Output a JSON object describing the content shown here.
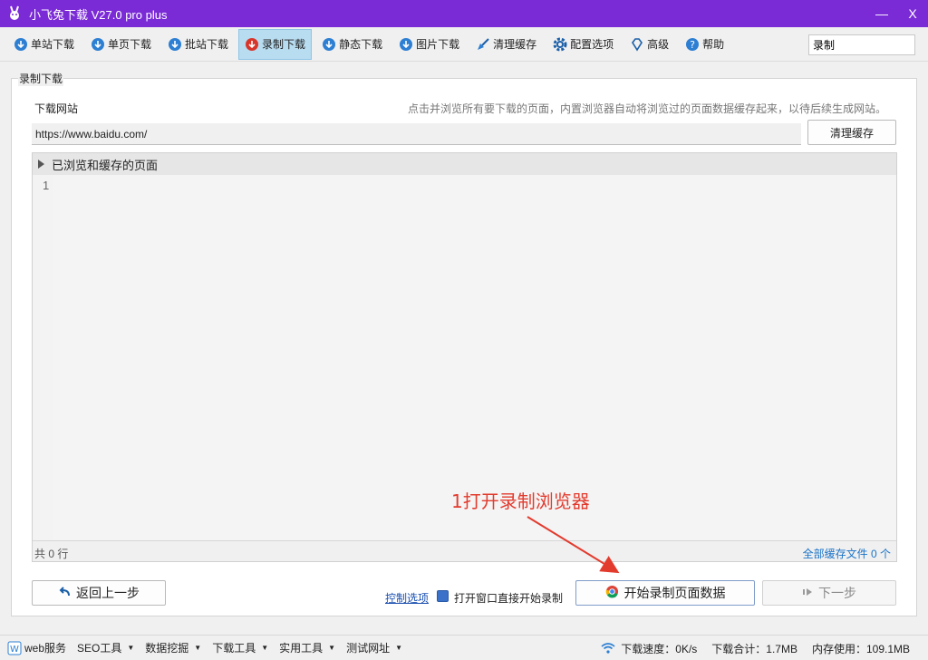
{
  "window": {
    "title": "小飞兔下载 V27.0 pro plus",
    "minimize": "—",
    "close": "X"
  },
  "toolbar": {
    "items": [
      {
        "label": "单站下载",
        "icon": "cloud-download-icon"
      },
      {
        "label": "单页下载",
        "icon": "cloud-download-icon"
      },
      {
        "label": "批站下载",
        "icon": "cloud-download-icon"
      },
      {
        "label": "录制下载",
        "icon": "cloud-record-icon",
        "active": true
      },
      {
        "label": "静态下载",
        "icon": "cloud-download-icon"
      },
      {
        "label": "图片下载",
        "icon": "cloud-download-icon"
      },
      {
        "label": "清理缓存",
        "icon": "broom-icon"
      },
      {
        "label": "配置选项",
        "icon": "gear-icon"
      },
      {
        "label": "高级",
        "icon": "diamond-icon"
      },
      {
        "label": "帮助",
        "icon": "help-icon"
      }
    ],
    "search_value": "录制"
  },
  "main": {
    "group_title": "录制下载",
    "site_label": "下载网站",
    "hint": "点击并浏览所有要下载的页面，内置浏览器自动将浏览过的页面数据缓存起来，以待后续生成网站。",
    "url_value": "https://www.baidu.com/",
    "clear_cache_button": "清理缓存",
    "panel_title": "已浏览和缓存的页面",
    "line_number": "1",
    "line_count": "共 0 行",
    "cache_files": "全部缓存文件 0 个",
    "annotation": "1打开录制浏览器"
  },
  "actions": {
    "back": "返回上一步",
    "control_options": "控制选项",
    "auto_record_label": "打开窗口直接开始录制",
    "auto_record_checked": true,
    "start": "开始录制页面数据",
    "next": "下一步"
  },
  "statusbar": {
    "items": [
      {
        "label": "web服务",
        "dropdown": false
      },
      {
        "label": "SEO工具",
        "dropdown": true
      },
      {
        "label": "数据挖掘",
        "dropdown": true
      },
      {
        "label": "下载工具",
        "dropdown": true
      },
      {
        "label": "实用工具",
        "dropdown": true
      },
      {
        "label": "测试网址",
        "dropdown": true
      }
    ],
    "speed": "下载速度：0K/s",
    "total": "下载合计：1.7MB",
    "memory": "内存使用：109.1MB"
  },
  "colors": {
    "titlebar": "#7b2bd6",
    "active_tab": "#b8dcf0",
    "annotation": "#e23b2e",
    "link": "#1a73c8"
  }
}
